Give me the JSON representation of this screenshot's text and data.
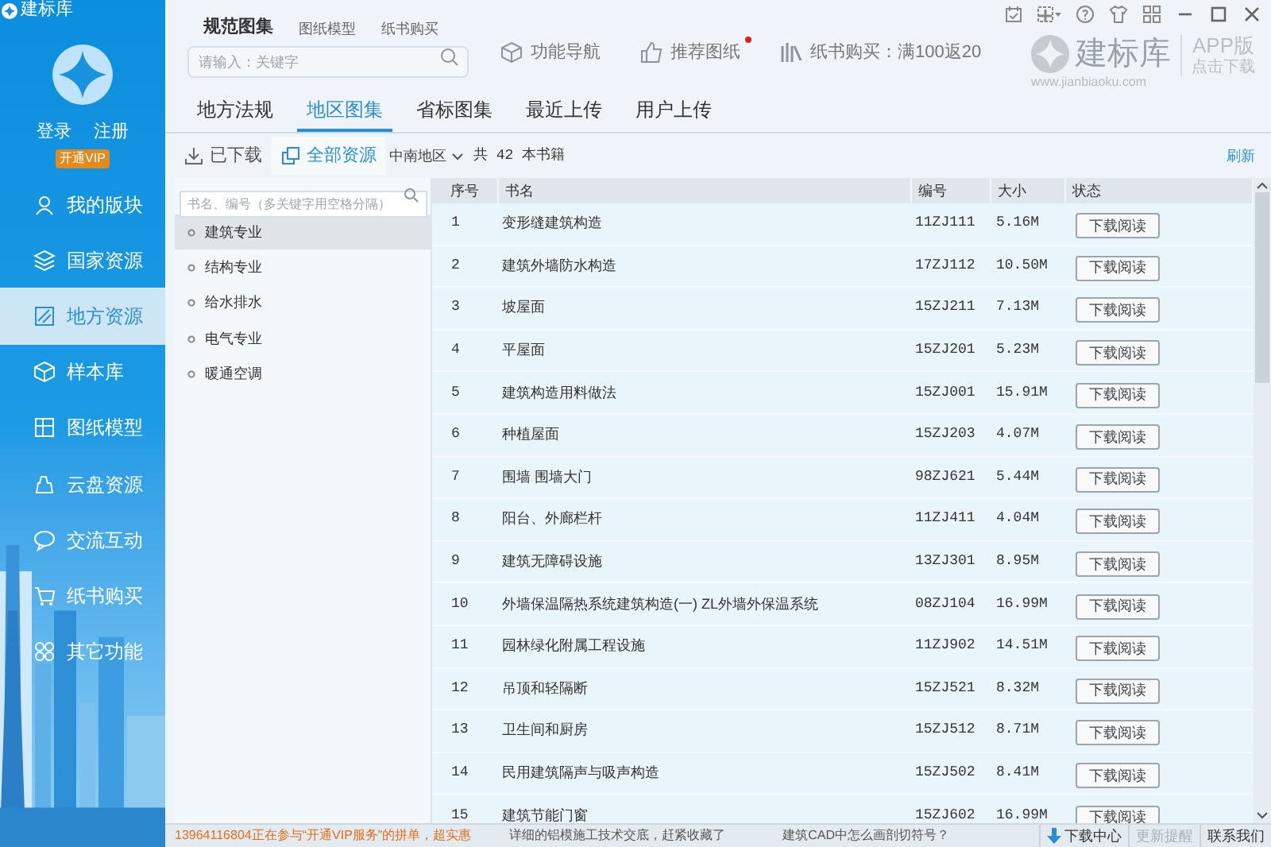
{
  "app_title": "建标库",
  "account": {
    "login": "登录",
    "register": "注册",
    "vip": "开通VIP"
  },
  "nav": [
    {
      "label": "我的版块",
      "selected": false
    },
    {
      "label": "国家资源",
      "selected": false
    },
    {
      "label": "地方资源",
      "selected": true
    },
    {
      "label": "样本库",
      "selected": false
    },
    {
      "label": "图纸模型",
      "selected": false
    },
    {
      "label": "云盘资源",
      "selected": false
    },
    {
      "label": "交流互动",
      "selected": false
    },
    {
      "label": "纸书购买",
      "selected": false
    },
    {
      "label": "其它功能",
      "selected": false
    }
  ],
  "top_tabs": [
    {
      "label": "规范图集",
      "selected": true
    },
    {
      "label": "图纸模型",
      "selected": false
    },
    {
      "label": "纸书购买",
      "selected": false
    }
  ],
  "search": {
    "placeholder": "请输入：关键字"
  },
  "toolbar": [
    {
      "label": "功能导航",
      "badge": false
    },
    {
      "label": "推荐图纸",
      "badge": true
    },
    {
      "label": "纸书购买：满100返20",
      "badge": false
    }
  ],
  "brand": {
    "name": "建标库",
    "url": "www.jianbiaoku.com",
    "app": "APP版",
    "app_link": "点击下载"
  },
  "tabs": [
    {
      "label": "地方法规",
      "selected": false
    },
    {
      "label": "地区图集",
      "selected": true
    },
    {
      "label": "省标图集",
      "selected": false
    },
    {
      "label": "最近上传",
      "selected": false
    },
    {
      "label": "用户上传",
      "selected": false
    }
  ],
  "subtabs": [
    {
      "label": "已下载",
      "selected": false
    },
    {
      "label": "全部资源",
      "selected": true
    }
  ],
  "region": "中南地区",
  "count_text": "共 42 本书籍",
  "refresh": "刷新",
  "category_search": {
    "placeholder": "书名、编号（多关键字用空格分隔）"
  },
  "categories": [
    {
      "label": "建筑专业",
      "selected": true
    },
    {
      "label": "结构专业",
      "selected": false
    },
    {
      "label": "给水排水",
      "selected": false
    },
    {
      "label": "电气专业",
      "selected": false
    },
    {
      "label": "暖通空调",
      "selected": false
    }
  ],
  "table": {
    "columns": [
      "序号",
      "书名",
      "编号",
      "大小",
      "状态"
    ],
    "rows": [
      {
        "no": "1",
        "name": "变形缝建筑构造",
        "code": "11ZJ111",
        "size": "5.16M",
        "action": "下载阅读"
      },
      {
        "no": "2",
        "name": "建筑外墙防水构造",
        "code": "17ZJ112",
        "size": "10.50M",
        "action": "下载阅读"
      },
      {
        "no": "3",
        "name": "坡屋面",
        "code": "15ZJ211",
        "size": "7.13M",
        "action": "下载阅读"
      },
      {
        "no": "4",
        "name": "平屋面",
        "code": "15ZJ201",
        "size": "5.23M",
        "action": "下载阅读"
      },
      {
        "no": "5",
        "name": "建筑构造用料做法",
        "code": "15ZJ001",
        "size": "15.91M",
        "action": "下载阅读"
      },
      {
        "no": "6",
        "name": "种植屋面",
        "code": "15ZJ203",
        "size": "4.07M",
        "action": "下载阅读"
      },
      {
        "no": "7",
        "name": "围墙 围墙大门",
        "code": "98ZJ621",
        "size": "5.44M",
        "action": "下载阅读"
      },
      {
        "no": "8",
        "name": "阳台、外廊栏杆",
        "code": "11ZJ411",
        "size": "4.04M",
        "action": "下载阅读"
      },
      {
        "no": "9",
        "name": "建筑无障碍设施",
        "code": "13ZJ301",
        "size": "8.95M",
        "action": "下载阅读"
      },
      {
        "no": "10",
        "name": "外墙保温隔热系统建筑构造(一) ZL外墙外保温系统",
        "code": "08ZJ104",
        "size": "16.99M",
        "action": "下载阅读"
      },
      {
        "no": "11",
        "name": "园林绿化附属工程设施",
        "code": "11ZJ902",
        "size": "14.51M",
        "action": "下载阅读"
      },
      {
        "no": "12",
        "name": "吊顶和轻隔断",
        "code": "15ZJ521",
        "size": "8.32M",
        "action": "下载阅读"
      },
      {
        "no": "13",
        "name": "卫生间和厨房",
        "code": "15ZJ512",
        "size": "8.71M",
        "action": "下载阅读"
      },
      {
        "no": "14",
        "name": "民用建筑隔声与吸声构造",
        "code": "15ZJ502",
        "size": "8.41M",
        "action": "下载阅读"
      },
      {
        "no": "15",
        "name": "建筑节能门窗",
        "code": "15ZJ602",
        "size": "16.99M",
        "action": "下载阅读"
      }
    ]
  },
  "status_bar": {
    "ticker": "13964116804正在参与“开通VIP服务”的拼单，超实惠",
    "news": [
      "详细的铝模施工技术交底，赶紧收藏了",
      "建筑CAD中怎么画剖切符号？"
    ],
    "buttons": [
      {
        "label": "下载中心",
        "disabled": false
      },
      {
        "label": "更新提醒",
        "disabled": true
      },
      {
        "label": "联系我们",
        "disabled": false
      }
    ]
  }
}
